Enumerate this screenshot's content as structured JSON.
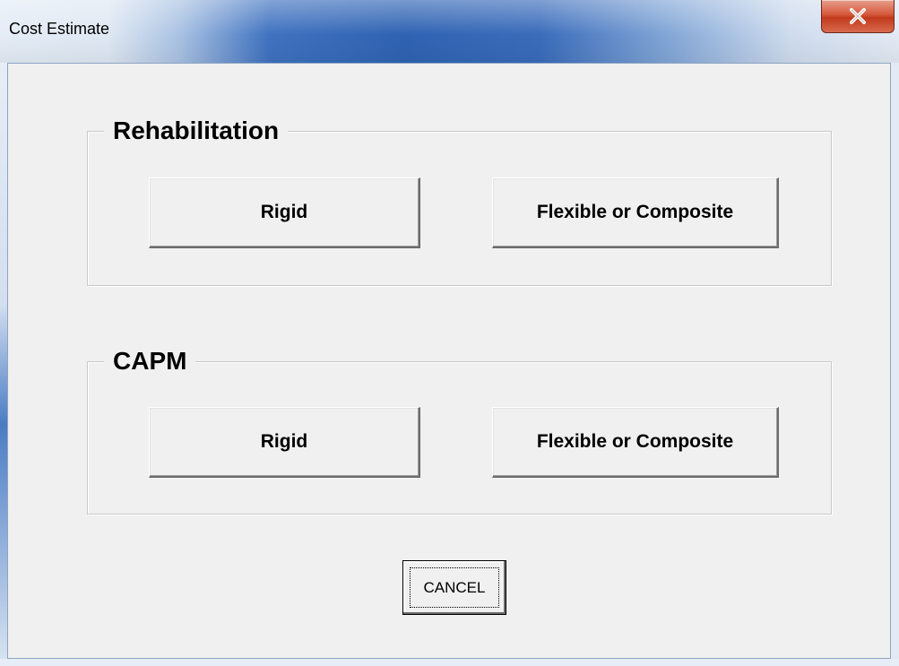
{
  "window": {
    "title": "Cost Estimate",
    "close_glyph": "x",
    "close_icon": "close-icon"
  },
  "rehabilitation": {
    "label": "Rehabilitation",
    "rigid_label": "Rigid",
    "flexible_label": "Flexible or Composite"
  },
  "capm": {
    "label": "CAPM",
    "rigid_label": "Rigid",
    "flexible_label": "Flexible or Composite"
  },
  "cancel": {
    "label": "CANCEL"
  },
  "colors": {
    "title_bar_accent": "#2f63b3",
    "dialog_background": "#f0f0f0",
    "close_button": "#c23a1c"
  }
}
